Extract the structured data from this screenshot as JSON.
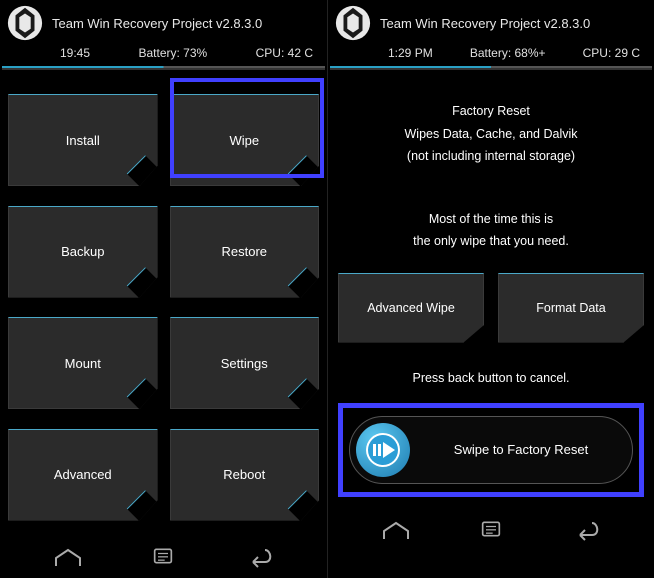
{
  "left": {
    "title": "Team Win Recovery Project  v2.8.3.0",
    "time": "19:45",
    "battery": "Battery: 73%",
    "cpu": "CPU: 42 C",
    "buttons": [
      "Install",
      "Wipe",
      "Backup",
      "Restore",
      "Mount",
      "Settings",
      "Advanced",
      "Reboot"
    ]
  },
  "right": {
    "title": "Team Win Recovery Project  v2.8.3.0",
    "time": "1:29 PM",
    "battery": "Battery: 68%+",
    "cpu": "CPU: 29 C",
    "info": {
      "line1": "Factory Reset",
      "line2": "Wipes Data, Cache, and Dalvik",
      "line3": "(not including internal storage)",
      "line4": "Most of the time this is",
      "line5": "the only wipe that you need."
    },
    "advanced_wipe": "Advanced Wipe",
    "format_data": "Format Data",
    "cancel_text": "Press back button to cancel.",
    "swipe_label": "Swipe to Factory Reset"
  }
}
